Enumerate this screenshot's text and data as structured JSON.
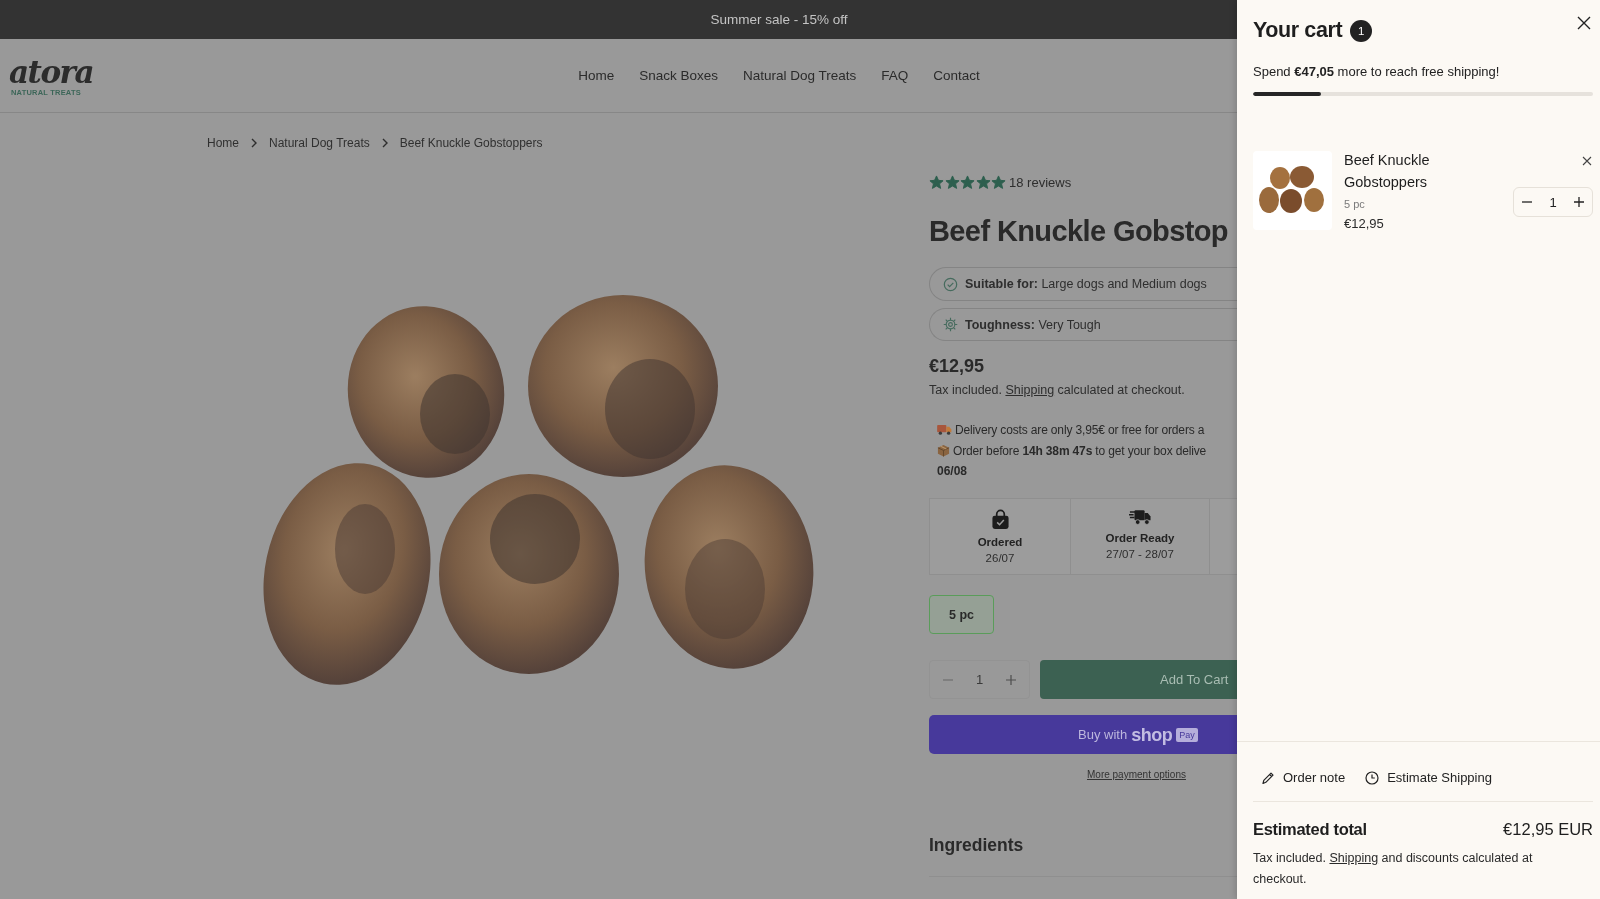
{
  "announcement": {
    "text": "Summer sale - 15% off"
  },
  "header": {
    "logo": {
      "wordmark": "atora",
      "tagline": "NATURAL TREATS"
    },
    "nav": [
      {
        "label": "Home"
      },
      {
        "label": "Snack Boxes"
      },
      {
        "label": "Natural Dog Treats"
      },
      {
        "label": "FAQ"
      },
      {
        "label": "Contact"
      }
    ]
  },
  "breadcrumb": [
    {
      "label": "Home"
    },
    {
      "label": "Natural Dog Treats"
    },
    {
      "label": "Beef Knuckle Gobstoppers"
    }
  ],
  "product": {
    "rating": {
      "stars": 5,
      "reviews": "18 reviews"
    },
    "title": "Beef Knuckle Gobstop",
    "attributes": [
      {
        "kind": "suitable",
        "text": "**Suitable for:** Large dogs and Medium dogs"
      },
      {
        "kind": "toughness",
        "text": "**Toughness:** Very Tough"
      }
    ],
    "price": "€12,95",
    "tax_note": {
      "before": "Tax included.",
      "link": "Shipping",
      "after": "calculated at checkout."
    },
    "delivery_notes": [
      {
        "kind": "truck",
        "text": "Delivery costs are only 3,95€ or free for orders a"
      },
      {
        "kind": "package",
        "text": "Order before **14h 38m 47s** to get your box delive"
      }
    ],
    "delivery_date": "06/08",
    "timeline": [
      {
        "kind": "bag",
        "label": "Ordered",
        "date": "26/07"
      },
      {
        "kind": "truck",
        "label": "Order Ready",
        "date": "27/07 - 28/07"
      }
    ],
    "variants": [
      {
        "label": "5 pc",
        "selected": true
      }
    ],
    "quantity": "1",
    "add_to_cart": "Add To Cart",
    "shop_pay": {
      "prefix": "Buy with",
      "brand": "shop",
      "badge": "Pay"
    },
    "more_payment": "More payment options",
    "sections": [
      {
        "title": "Ingredients"
      }
    ]
  },
  "cart": {
    "title": "Your cart",
    "count": "1",
    "shipping_message": "Spend **€47,05** more to reach free shipping!",
    "shipping_progress": {
      "level": 0.2
    },
    "items": [
      {
        "name": "Beef Knuckle Gobstoppers",
        "variant": "5 pc",
        "price": "€12,95",
        "quantity": "1"
      }
    ],
    "actions": [
      {
        "kind": "note",
        "label": "Order note"
      },
      {
        "kind": "shipping",
        "label": "Estimate Shipping"
      }
    ],
    "total_label": "Estimated total",
    "total": "€12,95 EUR",
    "footnote": {
      "before": "Tax included.",
      "link": "Shipping",
      "after": "and discounts calculated at checkout."
    }
  }
}
